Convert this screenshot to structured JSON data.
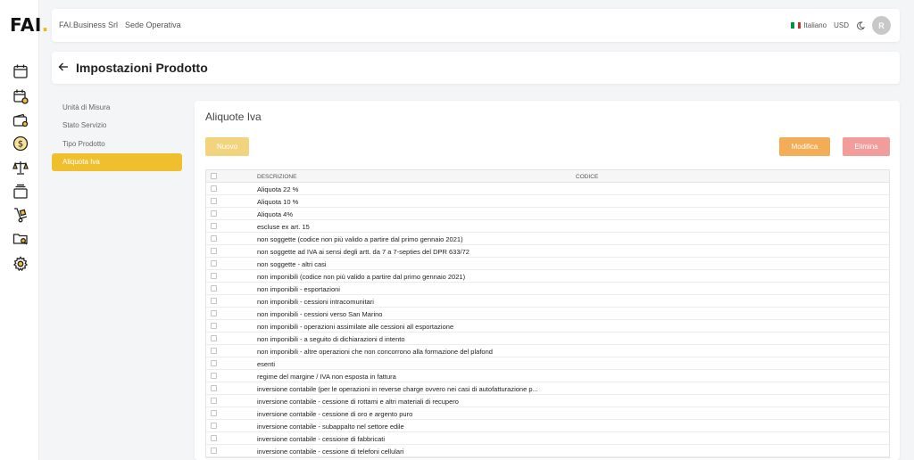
{
  "app": {
    "logo_text": "FAI",
    "logo_dot": ".",
    "accent_color": "#efbf2e"
  },
  "sidebar": {
    "icons": [
      "calendar-icon",
      "calendar-clock-icon",
      "wallet-icon",
      "dollar-circle-icon",
      "balance-scale-icon",
      "stack-icon",
      "hand-truck-icon",
      "folder-search-icon",
      "gear-icon"
    ]
  },
  "header": {
    "company": "FAI.Business Srl",
    "location": "Sede Operativa",
    "language": "Italiano",
    "currency": "USD",
    "avatar_initial": "R"
  },
  "page": {
    "title": "Impostazioni Prodotto"
  },
  "menu": {
    "items": [
      {
        "label": "Unità di Misura",
        "active": false
      },
      {
        "label": "Stato Servizio",
        "active": false
      },
      {
        "label": "Tipo Prodotto",
        "active": false
      },
      {
        "label": "Aliquota Iva",
        "active": true
      }
    ]
  },
  "panel": {
    "title": "Aliquote Iva",
    "buttons": {
      "new": "Nuovo",
      "edit": "Modifica",
      "delete": "Elimina"
    },
    "table": {
      "columns": [
        "DESCRIZIONE",
        "CODICE"
      ],
      "rows": [
        {
          "descrizione": "Aliquota 22 %",
          "codice": ""
        },
        {
          "descrizione": "Aliquota 10 %",
          "codice": ""
        },
        {
          "descrizione": "Aliquota 4%",
          "codice": ""
        },
        {
          "descrizione": "escluse ex art. 15",
          "codice": ""
        },
        {
          "descrizione": "non soggette (codice non più valido a partire dal primo gennaio 2021)",
          "codice": ""
        },
        {
          "descrizione": "non soggette ad IVA ai sensi degli artt. da 7 a 7-septies del DPR 633/72",
          "codice": ""
        },
        {
          "descrizione": "non soggette - altri casi",
          "codice": ""
        },
        {
          "descrizione": "non imponibili (codice non più valido a partire dal primo gennaio 2021)",
          "codice": ""
        },
        {
          "descrizione": "non imponibili - esportazioni",
          "codice": ""
        },
        {
          "descrizione": "non imponibili - cessioni intracomunitari",
          "codice": ""
        },
        {
          "descrizione": "non imponibili - cessioni verso San Marino",
          "codice": ""
        },
        {
          "descrizione": "non imponibili - operazioni assimilate alle cessioni all esportazione",
          "codice": ""
        },
        {
          "descrizione": "non imponibili - a seguito di dichiarazioni d intento",
          "codice": ""
        },
        {
          "descrizione": "non imponibili - altre operazioni che non concorrono alla formazione del plafond",
          "codice": ""
        },
        {
          "descrizione": "esenti",
          "codice": ""
        },
        {
          "descrizione": "regime del margine / IVA non esposta in fattura",
          "codice": ""
        },
        {
          "descrizione": "inversione contabile (per le operazioni in reverse charge ovvero nei casi di autofatturazione p...",
          "codice": ""
        },
        {
          "descrizione": "inversione contabile - cessione di rottami e altri materiali di recupero",
          "codice": ""
        },
        {
          "descrizione": "inversione contabile - cessione di oro e argento puro",
          "codice": ""
        },
        {
          "descrizione": "inversione contabile - subappalto nel settore edile",
          "codice": ""
        },
        {
          "descrizione": "inversione contabile - cessione di fabbricati",
          "codice": ""
        },
        {
          "descrizione": "inversione contabile - cessione di telefoni cellulari",
          "codice": ""
        }
      ]
    }
  }
}
